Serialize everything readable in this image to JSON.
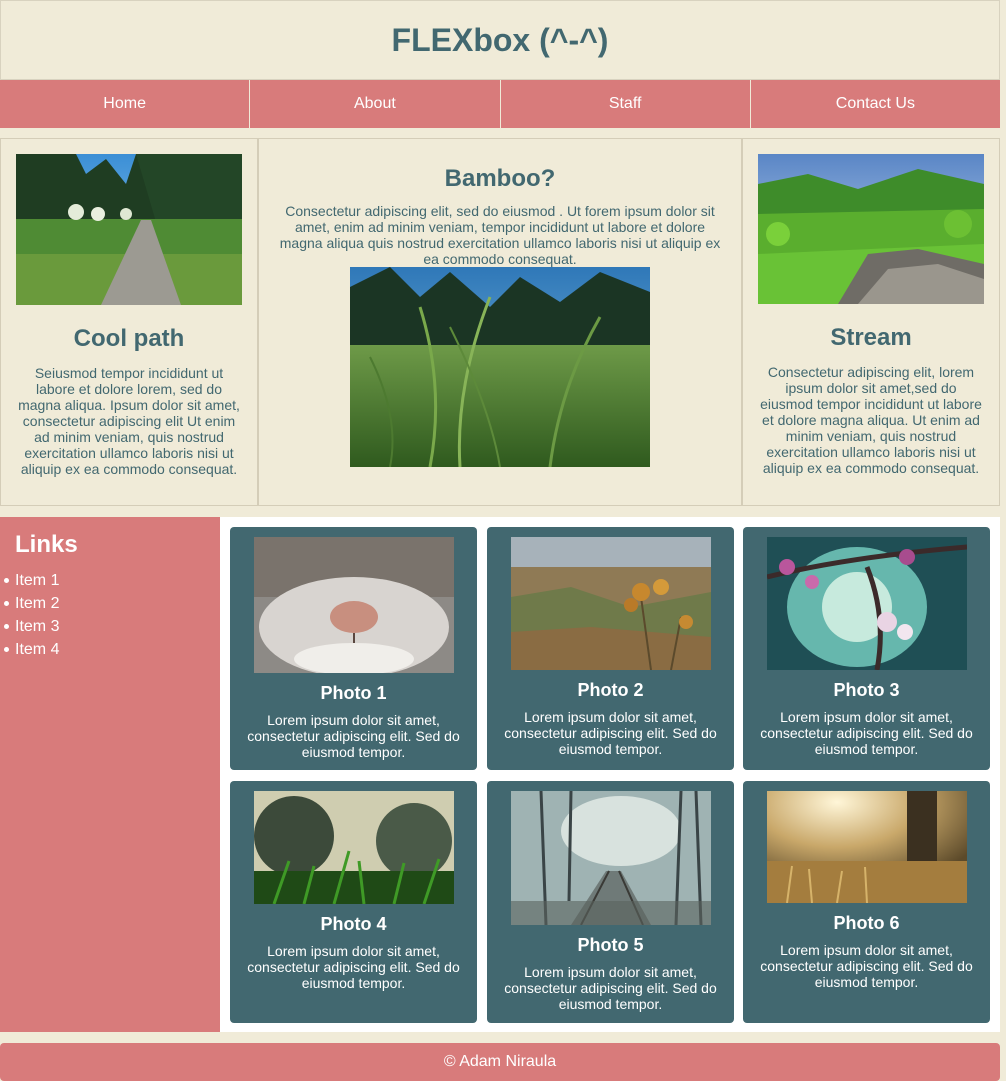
{
  "header": {
    "title": "FLEXbox (^-^)"
  },
  "nav": {
    "items": [
      {
        "label": "Home"
      },
      {
        "label": "About"
      },
      {
        "label": "Staff"
      },
      {
        "label": "Contact Us"
      }
    ]
  },
  "features": {
    "left": {
      "title": "Cool path",
      "text": "Seiusmod tempor incididunt ut labore et dolore lorem, sed do magna aliqua. Ipsum dolor sit amet, consectetur adipiscing elit Ut enim ad minim veniam, quis nostrud exercitation ullamco laboris nisi ut aliquip ex ea commodo consequat."
    },
    "center": {
      "title": "Bamboo?",
      "text": "Consectetur adipiscing elit, sed do eiusmod . Ut forem ipsum dolor sit amet, enim ad minim veniam, tempor incididunt ut labore et dolore magna aliqua quis nostrud exercitation ullamco laboris nisi ut aliquip ex ea commodo consequat."
    },
    "right": {
      "title": "Stream",
      "text": "Consectetur adipiscing elit, lorem ipsum dolor sit amet,sed do eiusmod tempor incididunt ut labore et dolore magna aliqua. Ut enim ad minim veniam, quis nostrud exercitation ullamco laboris nisi ut aliquip ex ea commodo consequat."
    }
  },
  "sidebar": {
    "title": "Links",
    "items": [
      {
        "label": "Item 1"
      },
      {
        "label": "Item 2"
      },
      {
        "label": "Item 3"
      },
      {
        "label": "Item 4"
      }
    ]
  },
  "gallery": {
    "cards": [
      {
        "title": "Photo 1",
        "text": "Lorem ipsum dolor sit amet, consectetur adipiscing elit. Sed do eiusmod tempor."
      },
      {
        "title": "Photo 2",
        "text": "Lorem ipsum dolor sit amet, consectetur adipiscing elit. Sed do eiusmod tempor."
      },
      {
        "title": "Photo 3",
        "text": "Lorem ipsum dolor sit amet, consectetur adipiscing elit. Sed do eiusmod tempor."
      },
      {
        "title": "Photo 4",
        "text": "Lorem ipsum dolor sit amet, consectetur adipiscing elit. Sed do eiusmod tempor."
      },
      {
        "title": "Photo 5",
        "text": "Lorem ipsum dolor sit amet, consectetur adipiscing elit. Sed do eiusmod tempor."
      },
      {
        "title": "Photo 6",
        "text": "Lorem ipsum dolor sit amet, consectetur adipiscing elit. Sed do eiusmod tempor."
      }
    ]
  },
  "footer": {
    "text": "© Adam Niraula"
  },
  "colors": {
    "accent": "#d87b7b",
    "teal": "#426870",
    "cream": "#f0ebd8"
  }
}
